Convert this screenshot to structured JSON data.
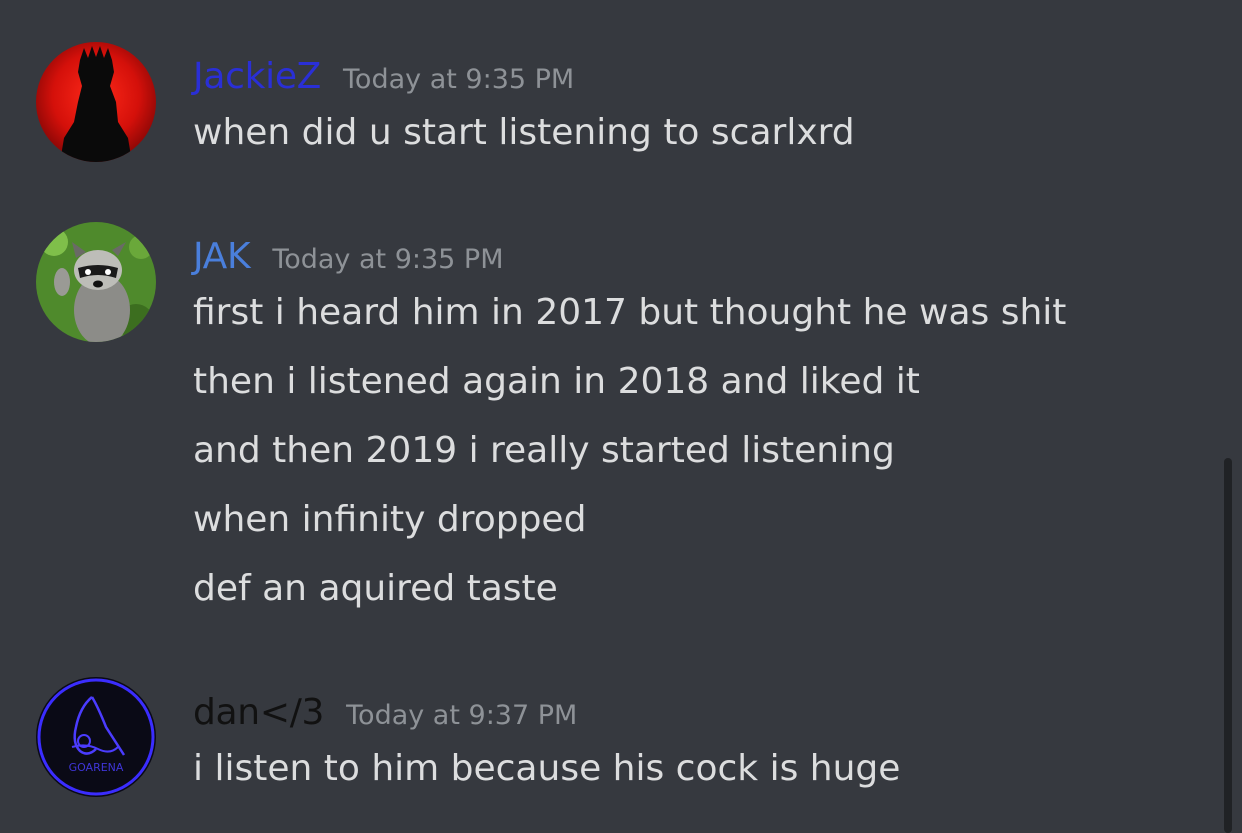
{
  "messages": [
    {
      "username": "JackieZ",
      "username_color": "#2a2fd6",
      "timestamp": "Today at 9:35 PM",
      "avatar_icon": "red-silhouette-avatar",
      "lines": [
        "when did u start listening to scarlxrd"
      ]
    },
    {
      "username": "JAK",
      "username_color": "#4a7fdc",
      "timestamp": "Today at 9:35 PM",
      "avatar_icon": "raccoon-avatar",
      "lines": [
        "first i heard him in 2017 but thought he was shit",
        "then i listened again in 2018 and liked it",
        "and then 2019 i really started listening",
        "when infinity dropped",
        "def an aquired taste"
      ]
    },
    {
      "username": "dan</3",
      "username_color": "#111111",
      "timestamp": "Today at 9:37 PM",
      "avatar_icon": "neon-goarena-avatar",
      "avatar_text": "GOARENA",
      "lines": [
        "i listen to him because his cock is huge"
      ]
    }
  ]
}
